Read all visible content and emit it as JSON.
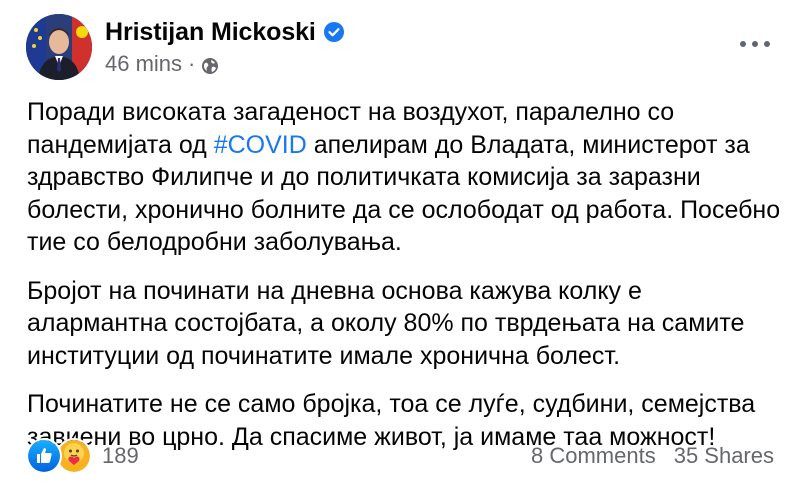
{
  "post": {
    "author": "Hristijan Mickoski",
    "time": "46 mins",
    "separator": "·",
    "body": {
      "p1_before": "Поради високата загаденост на воздухот, паралелно со пандемијата од ",
      "p1_hashtag": "#COVID",
      "p1_after": " апелирам до Владата, министерот за здравство Филипче и до политичката комисија за заразни болести, хронично болните да се ослободат од работа. Посебно тие со белодробни заболувања.",
      "p2": "Бројот на починати на дневна основа кажува колку е алармантна состојбата, а околу 80% по тврдењата на самите институции од починатите имале хронична болест.",
      "p3": "Починатите не се само бројка, тоа се луѓе, судбини, семејства завиени во црно. Да спасиме живот, ја имаме таа можност!"
    },
    "reactions_count": "189",
    "comments": "8 Comments",
    "shares": "35 Shares"
  },
  "colors": {
    "link": "#1877f2",
    "secondary_text": "#65676b",
    "verified": "#1877f2"
  },
  "icons": [
    "verified-badge-icon",
    "globe-icon",
    "more-options-icon",
    "like-reaction-icon",
    "care-reaction-icon"
  ]
}
